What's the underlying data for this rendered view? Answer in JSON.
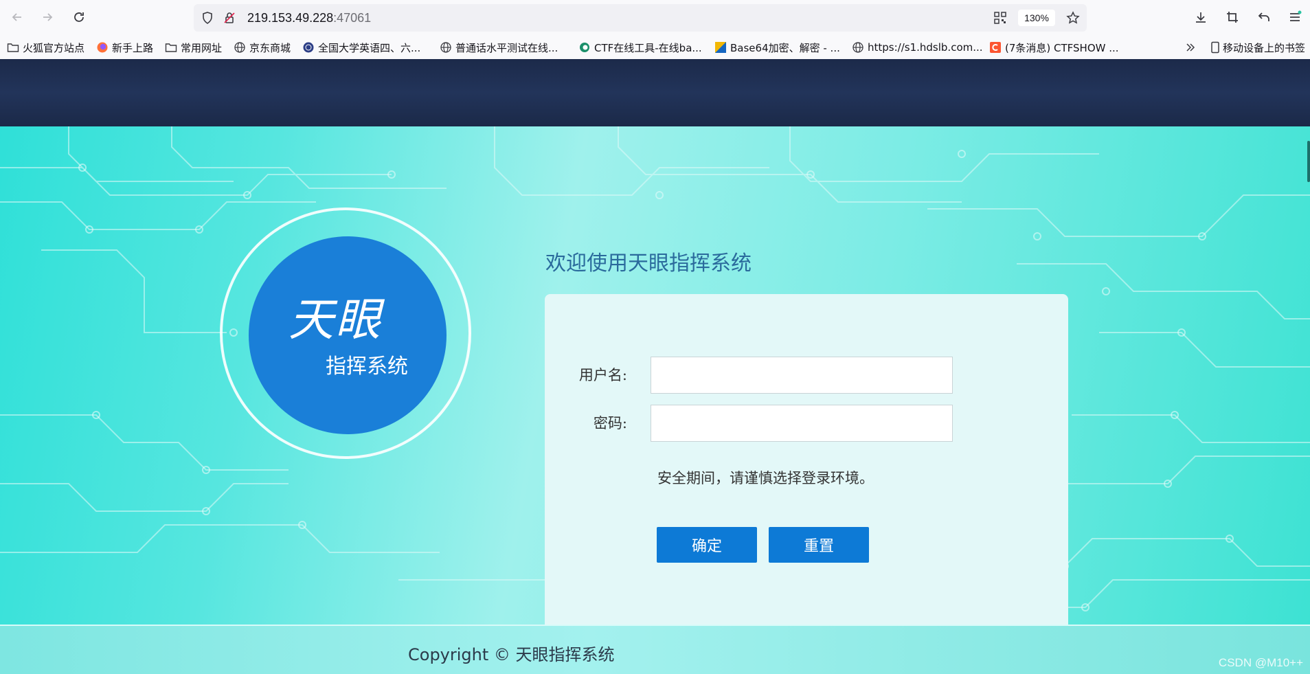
{
  "browser": {
    "url_host": "219.153.49.228",
    "url_port": ":47061",
    "zoom": "130%",
    "bookmarks": [
      {
        "label": "火狐官方站点",
        "icon": "folder-icon"
      },
      {
        "label": "新手上路",
        "icon": "firefox-icon"
      },
      {
        "label": "常用网址",
        "icon": "folder-icon"
      },
      {
        "label": "京东商城",
        "icon": "globe-icon"
      },
      {
        "label": "全国大学英语四、六...",
        "icon": "seal-icon"
      },
      {
        "label": "普通话水平测试在线...",
        "icon": "globe-icon"
      },
      {
        "label": "CTF在线工具-在线ba...",
        "icon": "ctf-tool-icon"
      },
      {
        "label": "Base64加密、解密 - ...",
        "icon": "base64-icon"
      },
      {
        "label": "https://s1.hdslb.com...",
        "icon": "globe-icon"
      },
      {
        "label": "(7条消息) CTFSHOW ...",
        "icon": "csdn-icon"
      }
    ],
    "mobile_bookmarks": "移动设备上的书签"
  },
  "logo": {
    "big": "天眼",
    "small": "指挥系统"
  },
  "welcome": "欢迎使用天眼指挥系统",
  "login": {
    "username_label": "用户名:",
    "password_label": "密码:",
    "username_value": "",
    "password_value": "",
    "notice": "安全期间，请谨慎选择登录环境。",
    "confirm_label": "确定",
    "reset_label": "重置"
  },
  "footer": {
    "copyright": "Copyright © 天眼指挥系统"
  },
  "watermark": "CSDN @M10++",
  "colors": {
    "brand_blue": "#1a7fd8",
    "button_blue": "#0d7ad6",
    "header_navy": "#1c2a4a",
    "teal": "#2fe0d8"
  }
}
